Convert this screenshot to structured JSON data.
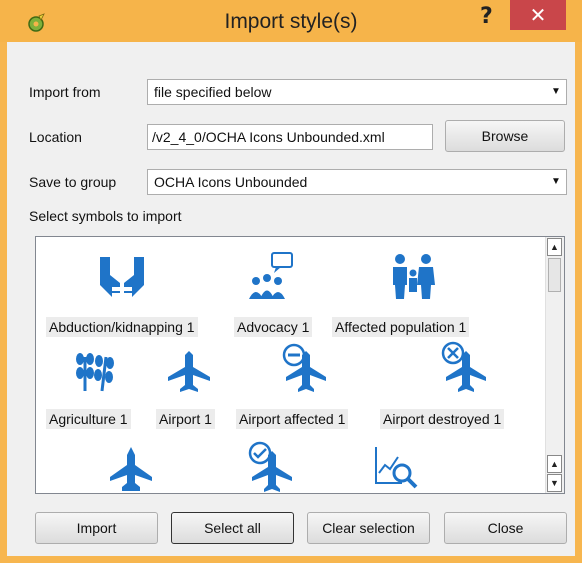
{
  "window": {
    "title": "Import style(s)",
    "help_symbol": "?",
    "close_symbol": "✕"
  },
  "form": {
    "import_from_label": "Import from",
    "import_from_value": "file specified below",
    "location_label": "Location",
    "location_value": "/v2_4_0/OCHA Icons Unbounded.xml",
    "browse_label": "Browse",
    "save_group_label": "Save to group",
    "save_group_value": "OCHA Icons Unbounded",
    "select_symbols_label": "Select symbols to import"
  },
  "symbols": [
    {
      "label": "Abduction/kidnapping 1",
      "icon": "abduction-icon"
    },
    {
      "label": "Advocacy 1",
      "icon": "advocacy-icon"
    },
    {
      "label": "Affected population 1",
      "icon": "affected-population-icon"
    },
    {
      "label": "Agriculture 1",
      "icon": "agriculture-icon"
    },
    {
      "label": "Airport 1",
      "icon": "airport-icon"
    },
    {
      "label": "Airport affected 1",
      "icon": "airport-affected-icon"
    },
    {
      "label": "Airport destroyed 1",
      "icon": "airport-destroyed-icon"
    }
  ],
  "buttons": {
    "import": "Import",
    "select_all": "Select all",
    "clear_selection": "Clear selection",
    "close": "Close"
  },
  "colors": {
    "titlebar": "#f6b44a",
    "close_button": "#c9464a",
    "icon_blue": "#1f74c8"
  }
}
